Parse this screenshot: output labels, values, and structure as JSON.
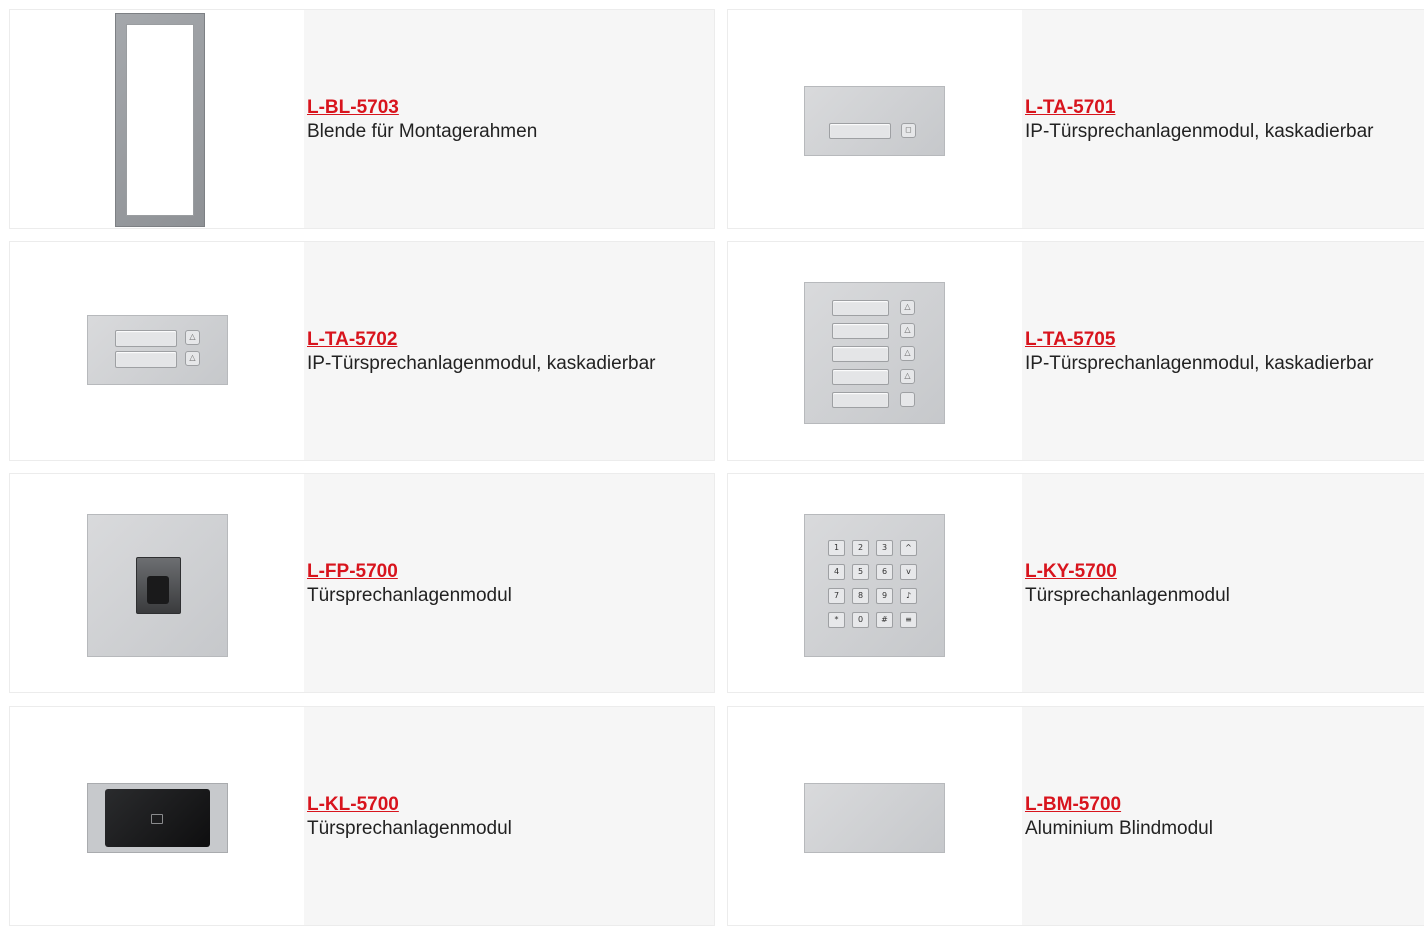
{
  "products": [
    {
      "sku": "L-BL-5703",
      "description": "Blende für Montagerahmen",
      "image_icon": "frame-bezel-icon"
    },
    {
      "sku": "L-TA-5701",
      "description": "IP-Türsprechanlagenmodul, kaskadierbar",
      "image_icon": "one-button-module-icon"
    },
    {
      "sku": "L-TA-5702",
      "description": "IP-Türsprechanlagenmodul, kaskadierbar",
      "image_icon": "two-button-module-icon"
    },
    {
      "sku": "L-TA-5705",
      "description": "IP-Türsprechanlagenmodul, kaskadierbar",
      "image_icon": "five-button-module-icon"
    },
    {
      "sku": "L-FP-5700",
      "description": "Türsprechanlagenmodul",
      "image_icon": "fingerprint-module-icon"
    },
    {
      "sku": "L-KY-5700",
      "description": "Türsprechanlagenmodul",
      "image_icon": "keypad-module-icon"
    },
    {
      "sku": "L-KL-5700",
      "description": "Türsprechanlagenmodul",
      "image_icon": "card-reader-module-icon"
    },
    {
      "sku": "L-BM-5700",
      "description": "Aluminium Blindmodul",
      "image_icon": "blank-module-icon"
    }
  ],
  "keypad": [
    "1",
    "2",
    "3",
    "^",
    "4",
    "5",
    "6",
    "v",
    "7",
    "8",
    "9",
    "♪",
    "*",
    "0",
    "#",
    "≡"
  ],
  "colors": {
    "sku_link": "#d8141d",
    "text_bg": "#f6f6f6"
  }
}
